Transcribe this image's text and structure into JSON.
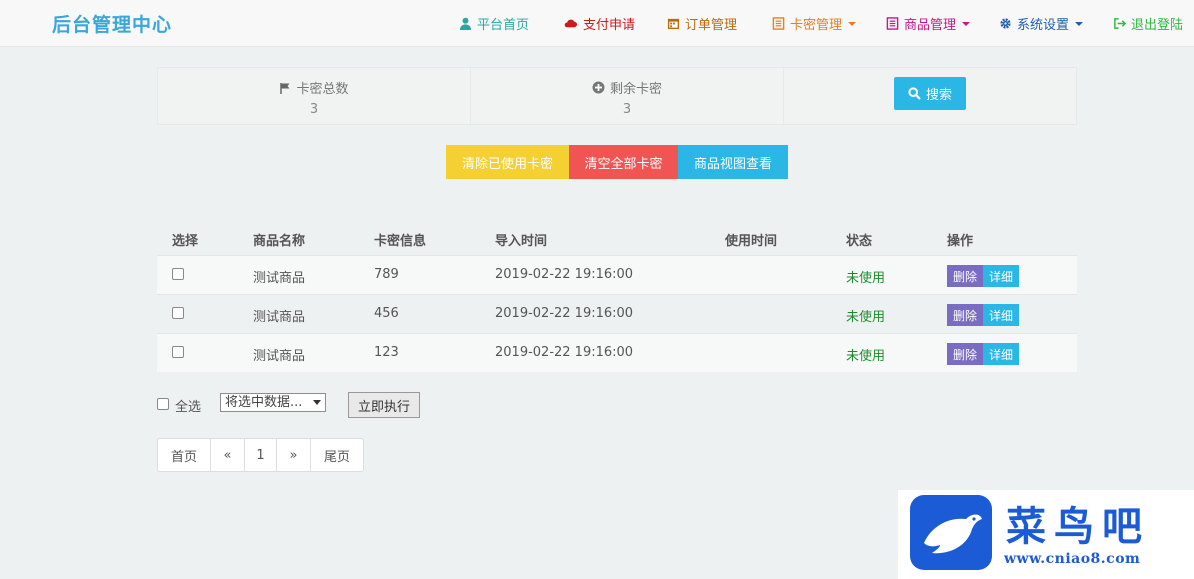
{
  "navbar": {
    "brand": "后台管理中心",
    "items": [
      {
        "label": "平台首页",
        "icon": "user-icon",
        "color": "#2aa7a0"
      },
      {
        "label": "支付申请",
        "icon": "cloud-icon",
        "color": "#d01919"
      },
      {
        "label": "订单管理",
        "icon": "calendar-icon",
        "color": "#b86b0f"
      },
      {
        "label": "卡密管理",
        "icon": "list-icon",
        "color": "#e67e22",
        "dropdown": true
      },
      {
        "label": "商品管理",
        "icon": "list-icon",
        "color": "#c2178f",
        "dropdown": true
      },
      {
        "label": "系统设置",
        "icon": "gear-icon",
        "color": "#1f5fa8",
        "dropdown": true
      },
      {
        "label": "退出登陆",
        "icon": "logout-icon",
        "color": "#2fb843"
      }
    ]
  },
  "stats": {
    "total_label": "卡密总数",
    "total_value": "3",
    "remaining_label": "剩余卡密",
    "remaining_value": "3",
    "search_label": "搜索"
  },
  "actions": {
    "clear_used": "清除已使用卡密",
    "clear_all": "清空全部卡密",
    "product_view": "商品视图查看",
    "colors": {
      "clear_used": "#f5d033",
      "clear_all": "#f05453",
      "product_view": "#2bb7e6"
    }
  },
  "table": {
    "headers": [
      "选择",
      "商品名称",
      "卡密信息",
      "导入时间",
      "使用时间",
      "状态",
      "操作"
    ],
    "rows": [
      {
        "product": "测试商品",
        "card": "789",
        "import_time": "2019-02-22 19:16:00",
        "use_time": "",
        "status": "未使用"
      },
      {
        "product": "测试商品",
        "card": "456",
        "import_time": "2019-02-22 19:16:00",
        "use_time": "",
        "status": "未使用"
      },
      {
        "product": "测试商品",
        "card": "123",
        "import_time": "2019-02-22 19:16:00",
        "use_time": "",
        "status": "未使用"
      }
    ],
    "delete_label": "删除",
    "detail_label": "详细",
    "delete_color": "#7a6cc2",
    "detail_color": "#2bb7e6"
  },
  "bulk": {
    "select_all": "全选",
    "selected_option": "将选中数据...",
    "execute": "立即执行"
  },
  "pagination": [
    "首页",
    "«",
    "1",
    "»",
    "尾页"
  ],
  "watermark": {
    "title": "菜鸟吧",
    "url": "www.cniao8.com"
  }
}
